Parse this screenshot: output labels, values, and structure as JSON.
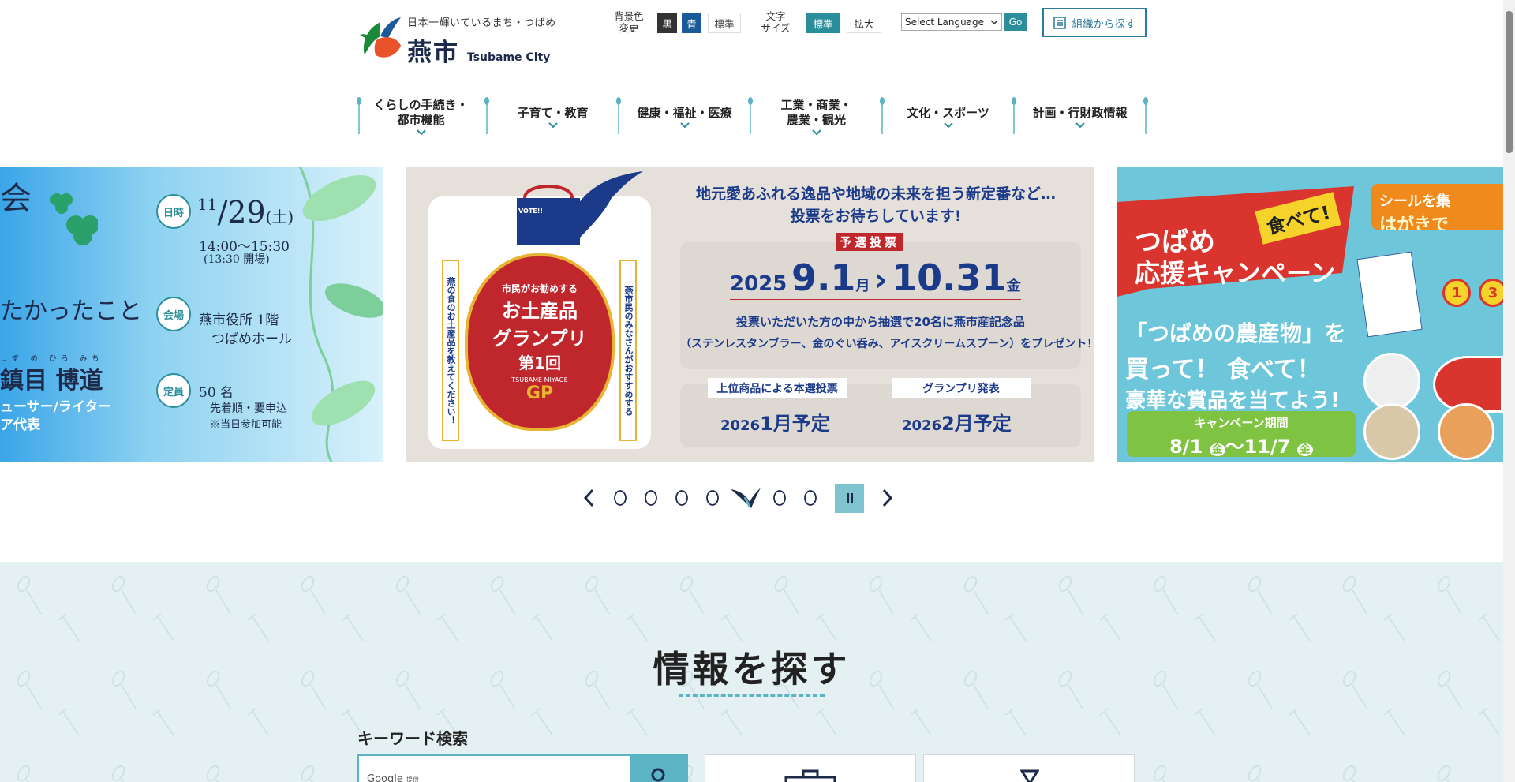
{
  "header": {
    "tagline": "日本一輝いているまち・つばめ",
    "city_name": "燕市",
    "city_name_en": "Tsubame City",
    "bg_color_label": "背景色\n変更",
    "bg_black": "黒",
    "bg_blue": "青",
    "bg_standard": "標準",
    "font_size_label": "文字\nサイズ",
    "font_standard": "標準",
    "font_large": "拡大",
    "language_select": "Select Language",
    "go_label": "Go",
    "org_search": "組織から探す"
  },
  "nav": [
    {
      "line1": "くらしの手続き・",
      "line2": "都市機能"
    },
    {
      "line1": "子育て・教育",
      "line2": ""
    },
    {
      "line1": "健康・福祉・医療",
      "line2": ""
    },
    {
      "line1": "工業・商業・",
      "line2": "農業・観光"
    },
    {
      "line1": "文化・スポーツ",
      "line2": ""
    },
    {
      "line1": "計画・行財政情報",
      "line2": ""
    }
  ],
  "slides": {
    "left": {
      "heading_fragment": "会",
      "date_label": "日時",
      "date_month": "11",
      "date_day": "/29",
      "date_weekday": "(土)",
      "time": "14:00〜15:30",
      "time_note": "(13:30 開場)",
      "headline_fragment": "たかったこと",
      "venue_label": "会場",
      "venue_line1": "燕市役所 1階",
      "venue_line2": "つばめホール",
      "speaker_ruby": "しず め  ひろ みち",
      "speaker": "鎮目 博道",
      "role1": "ューサー/ライター",
      "role2": "ア代表",
      "capacity_label": "定員",
      "capacity": "50 名",
      "capacity_note1": "先着順・要申込",
      "capacity_note2": "※当日参加可能"
    },
    "center": {
      "bag_text": "VOTE!!",
      "side_left": "燕の食のお土産品を教えてください！",
      "side_right": "燕市民のみなさんがおすすめする",
      "badge_small": "市民がお勧めする",
      "badge_main1": "お土産品",
      "badge_main2": "グランプリ",
      "badge_round": "第1回",
      "badge_en": "TSUBAME MIYAGE",
      "badge_gp": "GP",
      "headline1": "地元愛あふれる逸品や地域の未来を担う新定番など…",
      "headline2": "投票をお待ちしています!",
      "prelim": "予選投票",
      "year": "2025",
      "date_from": "9.1",
      "date_from_wd": "月",
      "date_to": "10.31",
      "date_to_wd": "金",
      "prize1": "投票いただいた方の中から抽選で20名に燕市産記念品",
      "prize2": "（ステンレスタンブラー、金のぐい呑み、アイスクリームスプーン）をプレゼント！",
      "final_label": "上位商品による本選投票",
      "final_year": "2026",
      "final_date": "1月予定",
      "gp_label": "グランプリ発表",
      "gp_year": "2026",
      "gp_date": "2月予定"
    },
    "right": {
      "flag_title1": "つばめ",
      "flag_title2": "応援キャンペーン",
      "eat": "食べて!",
      "line1": "「つばめの農産物」を",
      "line2": "買って！ 食べて！",
      "line3": "豪華な賞品を当てよう!",
      "period_label": "キャンペーン期間",
      "period_from": "8/1",
      "period_from_wd": "金",
      "period_to": "〜11/7",
      "period_to_wd": "金",
      "seal1": "シールを集",
      "seal2": "はがきで",
      "seal_badge1": "1",
      "seal_badge2": "3"
    }
  },
  "carousel": {
    "dot_count": 8,
    "active_index": 4
  },
  "search_section": {
    "title": "情報を探す",
    "keyword_label": "キーワード検索",
    "google_label": "Google",
    "google_sub": "提供"
  },
  "colors": {
    "teal": "#2a8f9a",
    "blue": "#1b5a9a",
    "light_teal": "#5ab4c4",
    "navy": "#1d2a4a",
    "red": "#c0272d"
  }
}
